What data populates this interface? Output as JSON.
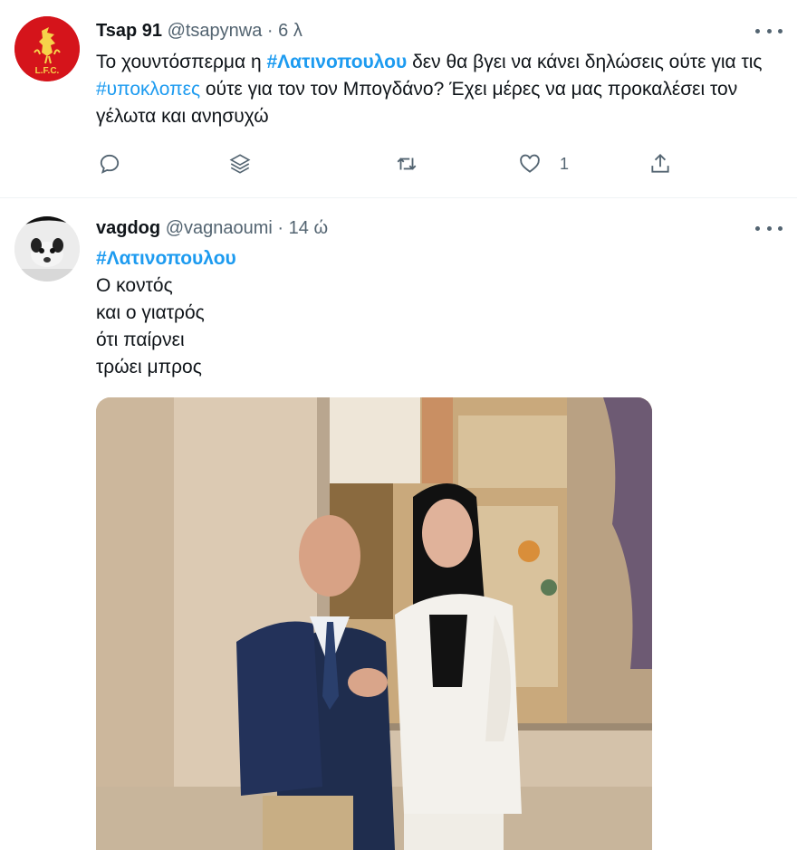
{
  "tweets": [
    {
      "name": "Tsap 91",
      "handle": "@tsapynwa",
      "dot": "·",
      "time": "6 λ",
      "avatar_icon": "liverpool-fc-crest-icon",
      "text": {
        "p1": "Το χουντόσπερμα η ",
        "tag1": "#Λατινοπουλου",
        "p2": " δεν θα βγει να κάνει δηλώσεις ούτε για τις ",
        "tag2": "#υποκλοπες",
        "p3": " ούτε για τον τον Μπογδάνο? Έχει μέρες να μας προκαλέσει τον γέλωτα και ανησυχώ"
      },
      "actions": {
        "reply_icon": "reply-icon",
        "stack_icon": "stack-icon",
        "retweet_icon": "retweet-icon",
        "like_icon": "heart-icon",
        "like_count": "1",
        "share_icon": "share-icon"
      }
    },
    {
      "name": "vagdog",
      "handle": "@vagnaoumi",
      "dot": "·",
      "time": "14 ώ",
      "avatar_icon": "dog-avatar",
      "hashtag": "#Λατινοπουλου",
      "lines": [
        "Ο κοντός",
        "και ο γιατρός",
        "ότι παίρνει",
        "τρώει μπρος"
      ],
      "photo_icon": "handshake-photo"
    }
  ],
  "colors": {
    "link": "#1d9bf0",
    "secondary_text": "#536471",
    "divider": "#eff3f4"
  }
}
